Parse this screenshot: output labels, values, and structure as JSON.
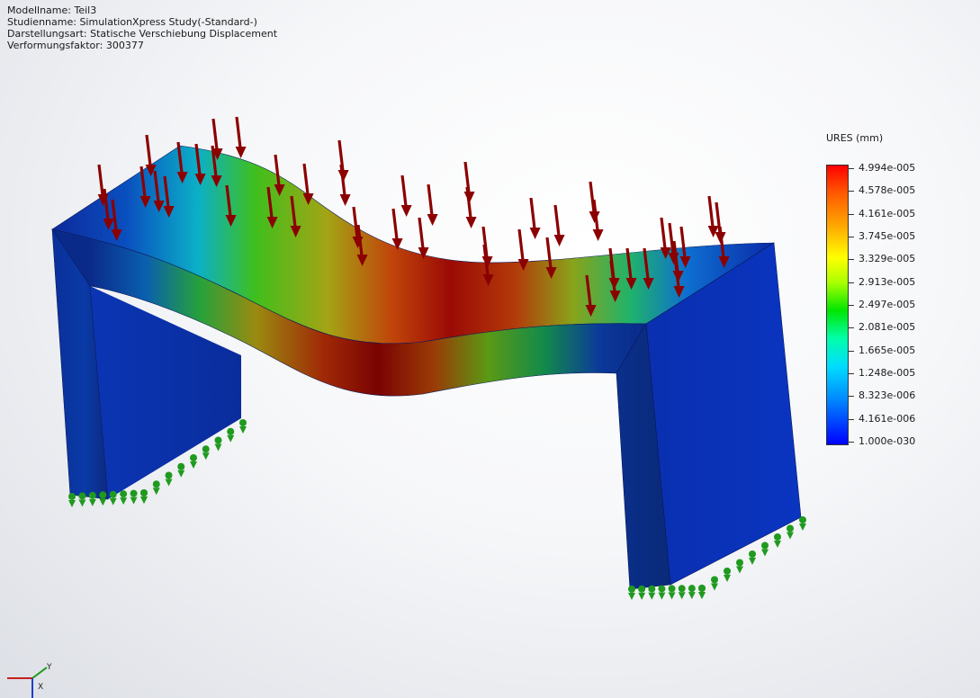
{
  "info": {
    "model": "Modellname: Teil3",
    "study": "Studienname: SimulationXpress Study(-Standard-)",
    "plot_type": "Darstellungsart: Statische Verschiebung Displacement",
    "deformation": "Verformungsfaktor: 300377"
  },
  "legend": {
    "title": "URES (mm)",
    "values": [
      "4.994e-005",
      "4.578e-005",
      "4.161e-005",
      "3.745e-005",
      "3.329e-005",
      "2.913e-005",
      "2.497e-005",
      "2.081e-005",
      "1.665e-005",
      "1.248e-005",
      "8.323e-006",
      "4.161e-006",
      "1.000e-030"
    ]
  },
  "colors": {
    "max": "#ff0000",
    "min": "#0000ff",
    "load_arrow": "#8b0000",
    "fixture": "#1f9a1f"
  },
  "triad": {
    "x_axis": "X",
    "y_axis": "Y"
  }
}
